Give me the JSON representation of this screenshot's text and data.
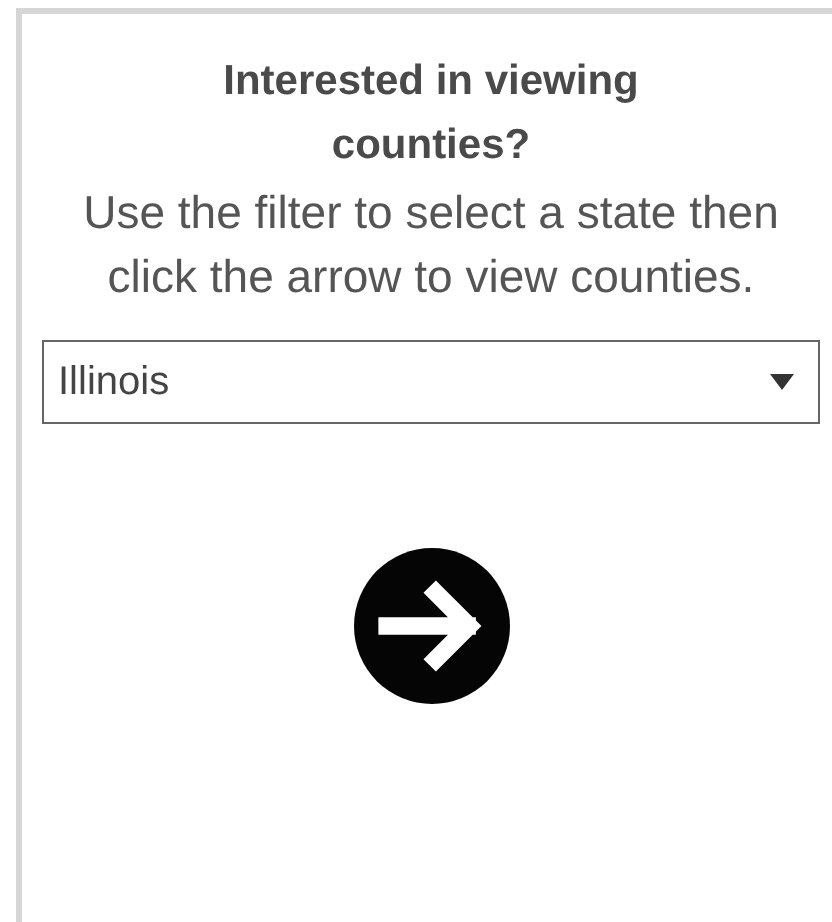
{
  "heading": "Interested in viewing counties?",
  "instructions": "Use the filter to select a state then click the arrow to view counties.",
  "filter": {
    "value": "Illinois"
  }
}
